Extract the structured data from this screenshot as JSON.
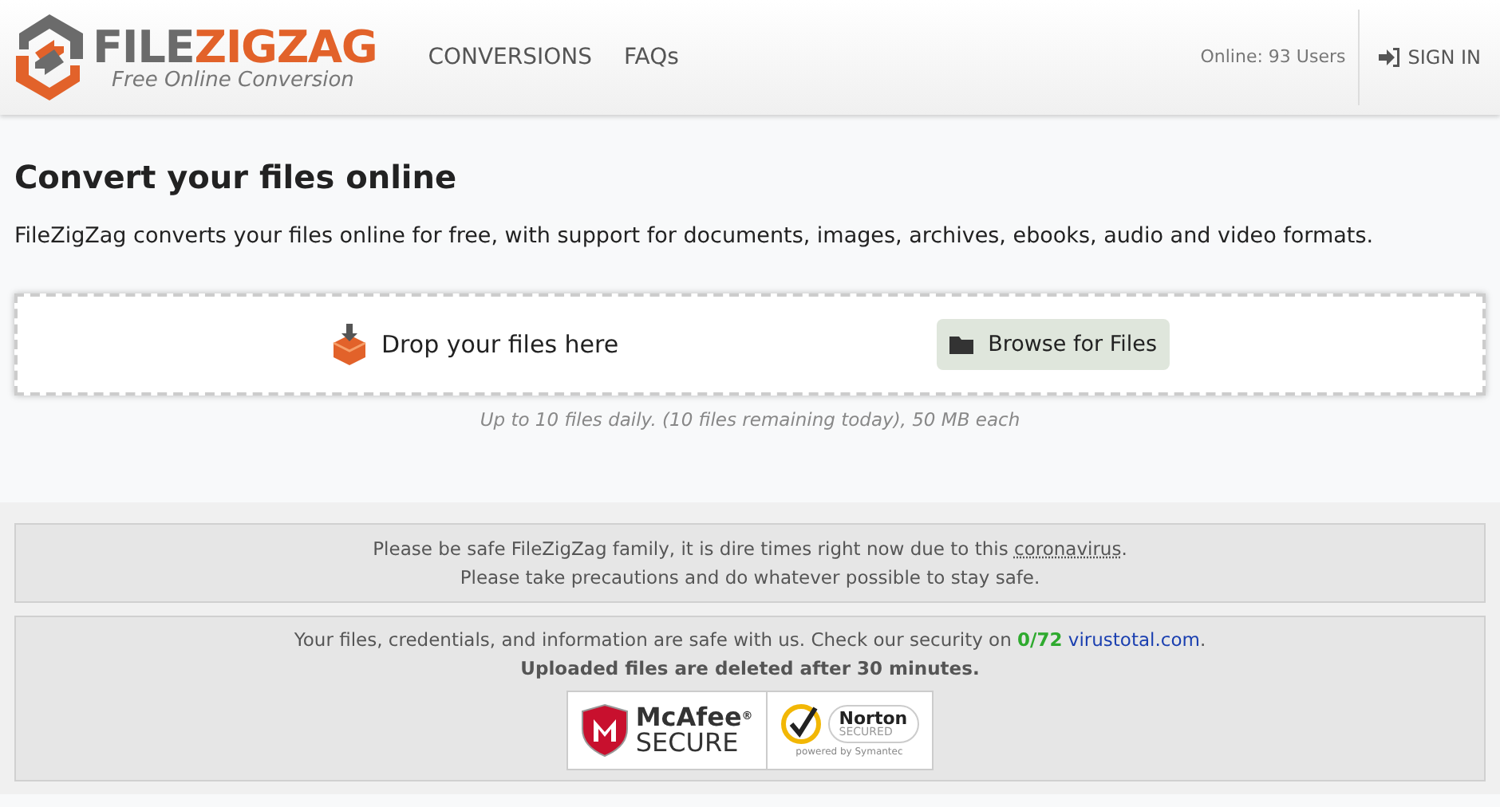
{
  "header": {
    "logo": {
      "part_1": "FILE",
      "part_2": "ZIGZAG",
      "tagline": "Free Online Conversion"
    },
    "nav": [
      {
        "label": "CONVERSIONS"
      },
      {
        "label": "FAQs"
      }
    ],
    "online": "Online: 93 Users",
    "sign_in": "SIGN IN"
  },
  "title": "Convert your files online",
  "intro": "FileZigZag converts your files online for free, with support for documents, images, archives, ebooks, audio and video formats.",
  "upload": {
    "drop": "Drop your files here",
    "browse": "Browse for Files",
    "limits": "Up to 10 files daily. (10 files remaining today), 50 MB each"
  },
  "notice": {
    "line_1": "Please be safe FileZigZag family, it is dire times right now due to this",
    "link": "coronavirus",
    "line_1_end": ".",
    "line_2": "Please take precautions and do whatever possible to stay safe."
  },
  "security": {
    "text": "Your files, credentials, and information are safe with us. Check our security on",
    "score": "0/72",
    "link": "virustotal.com",
    "end": ".",
    "note": "Uploaded files are deleted after 30 minutes.",
    "badges": [
      {
        "kind": "mcafee",
        "brand": "McAfee",
        "label": "SECURE",
        "mark": "®"
      },
      {
        "kind": "norton",
        "brand": "Norton",
        "label": "SECURED",
        "footer": "powered by Symantec"
      }
    ]
  }
}
